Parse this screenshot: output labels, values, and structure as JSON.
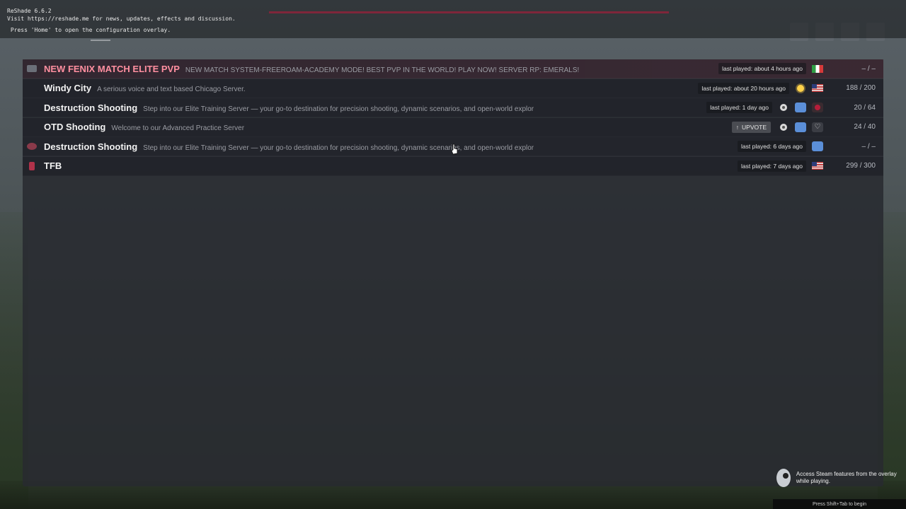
{
  "reshade": {
    "version": "ReShade 6.6.2",
    "visit": "Visit https://reshade.me for news, updates, effects and discussion.",
    "hint": " Press 'Home' to open the configuration overlay."
  },
  "servers": [
    {
      "name": "NEW FENIX MATCH ELITE PVP",
      "description": "NEW MATCH SYSTEM-FREEROAM-ACADEMY MODE! BEST PVP IN THE WORLD! PLAY NOW! SERVER RP: EMERALS!",
      "last_played": "last played: about 4 hours ago",
      "players": "– / –"
    },
    {
      "name": "Windy City",
      "description": "A serious voice and text based Chicago Server.",
      "last_played": "last played: about 20 hours ago",
      "players": "188 / 200"
    },
    {
      "name": "Destruction Shooting",
      "description": "Step into our Elite Training Server — your go-to destination for precision shooting, dynamic scenarios, and open-world explor",
      "last_played": "last played: 1 day ago",
      "players": "20 / 64"
    },
    {
      "name": "OTD Shooting",
      "description": "Welcome to our Advanced Practice Server",
      "upvote": "UPVOTE",
      "players": "24 / 40"
    },
    {
      "name": "Destruction Shooting",
      "description": "Step into our Elite Training Server — your go-to destination for precision shooting, dynamic scenarios, and open-world explor",
      "last_played": "last played: 6 days ago",
      "players": "– / –"
    },
    {
      "name": "TFB",
      "description": "",
      "last_played": "last played: 7 days ago",
      "players": "299 / 300"
    }
  ],
  "steam": {
    "popup": "Access Steam features from the overlay while playing.",
    "hint": "Press Shift+Tab to begin"
  },
  "colors": {
    "featured_name": "#ff8fa0",
    "shield_blue": "#5b8fd8",
    "reshade_bar": "#a0203a"
  }
}
